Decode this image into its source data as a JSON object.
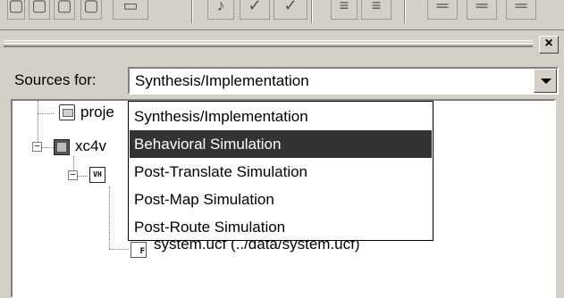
{
  "toolbar": {
    "icons": [
      "toolbar-icon-1",
      "toolbar-icon-2",
      "toolbar-icon-3",
      "toolbar-icon-4",
      "toolbar-icon-5",
      "toolbar-icon-6",
      "toolbar-icon-7",
      "toolbar-icon-8",
      "indent-icon",
      "outdent-icon",
      "align-left-icon",
      "align-center-icon",
      "align-right-icon"
    ]
  },
  "panel": {
    "close_label": "×"
  },
  "sources": {
    "label": "Sources for:",
    "selected": "Synthesis/Implementation",
    "options": [
      "Synthesis/Implementation",
      "Behavioral Simulation",
      "Post-Translate Simulation",
      "Post-Map Simulation",
      "Post-Route Simulation"
    ],
    "highlighted": "Behavioral Simulation"
  },
  "tree": {
    "project_label": "proje",
    "device_label": "xc4v",
    "module_label": "",
    "ucf_label": "system.ucf (../data/system.ucf)",
    "vh_icon_text": "VH",
    "ucf_icon_text": "F"
  },
  "colors": {
    "background": "#d4d0c8",
    "highlight": "#333333"
  }
}
